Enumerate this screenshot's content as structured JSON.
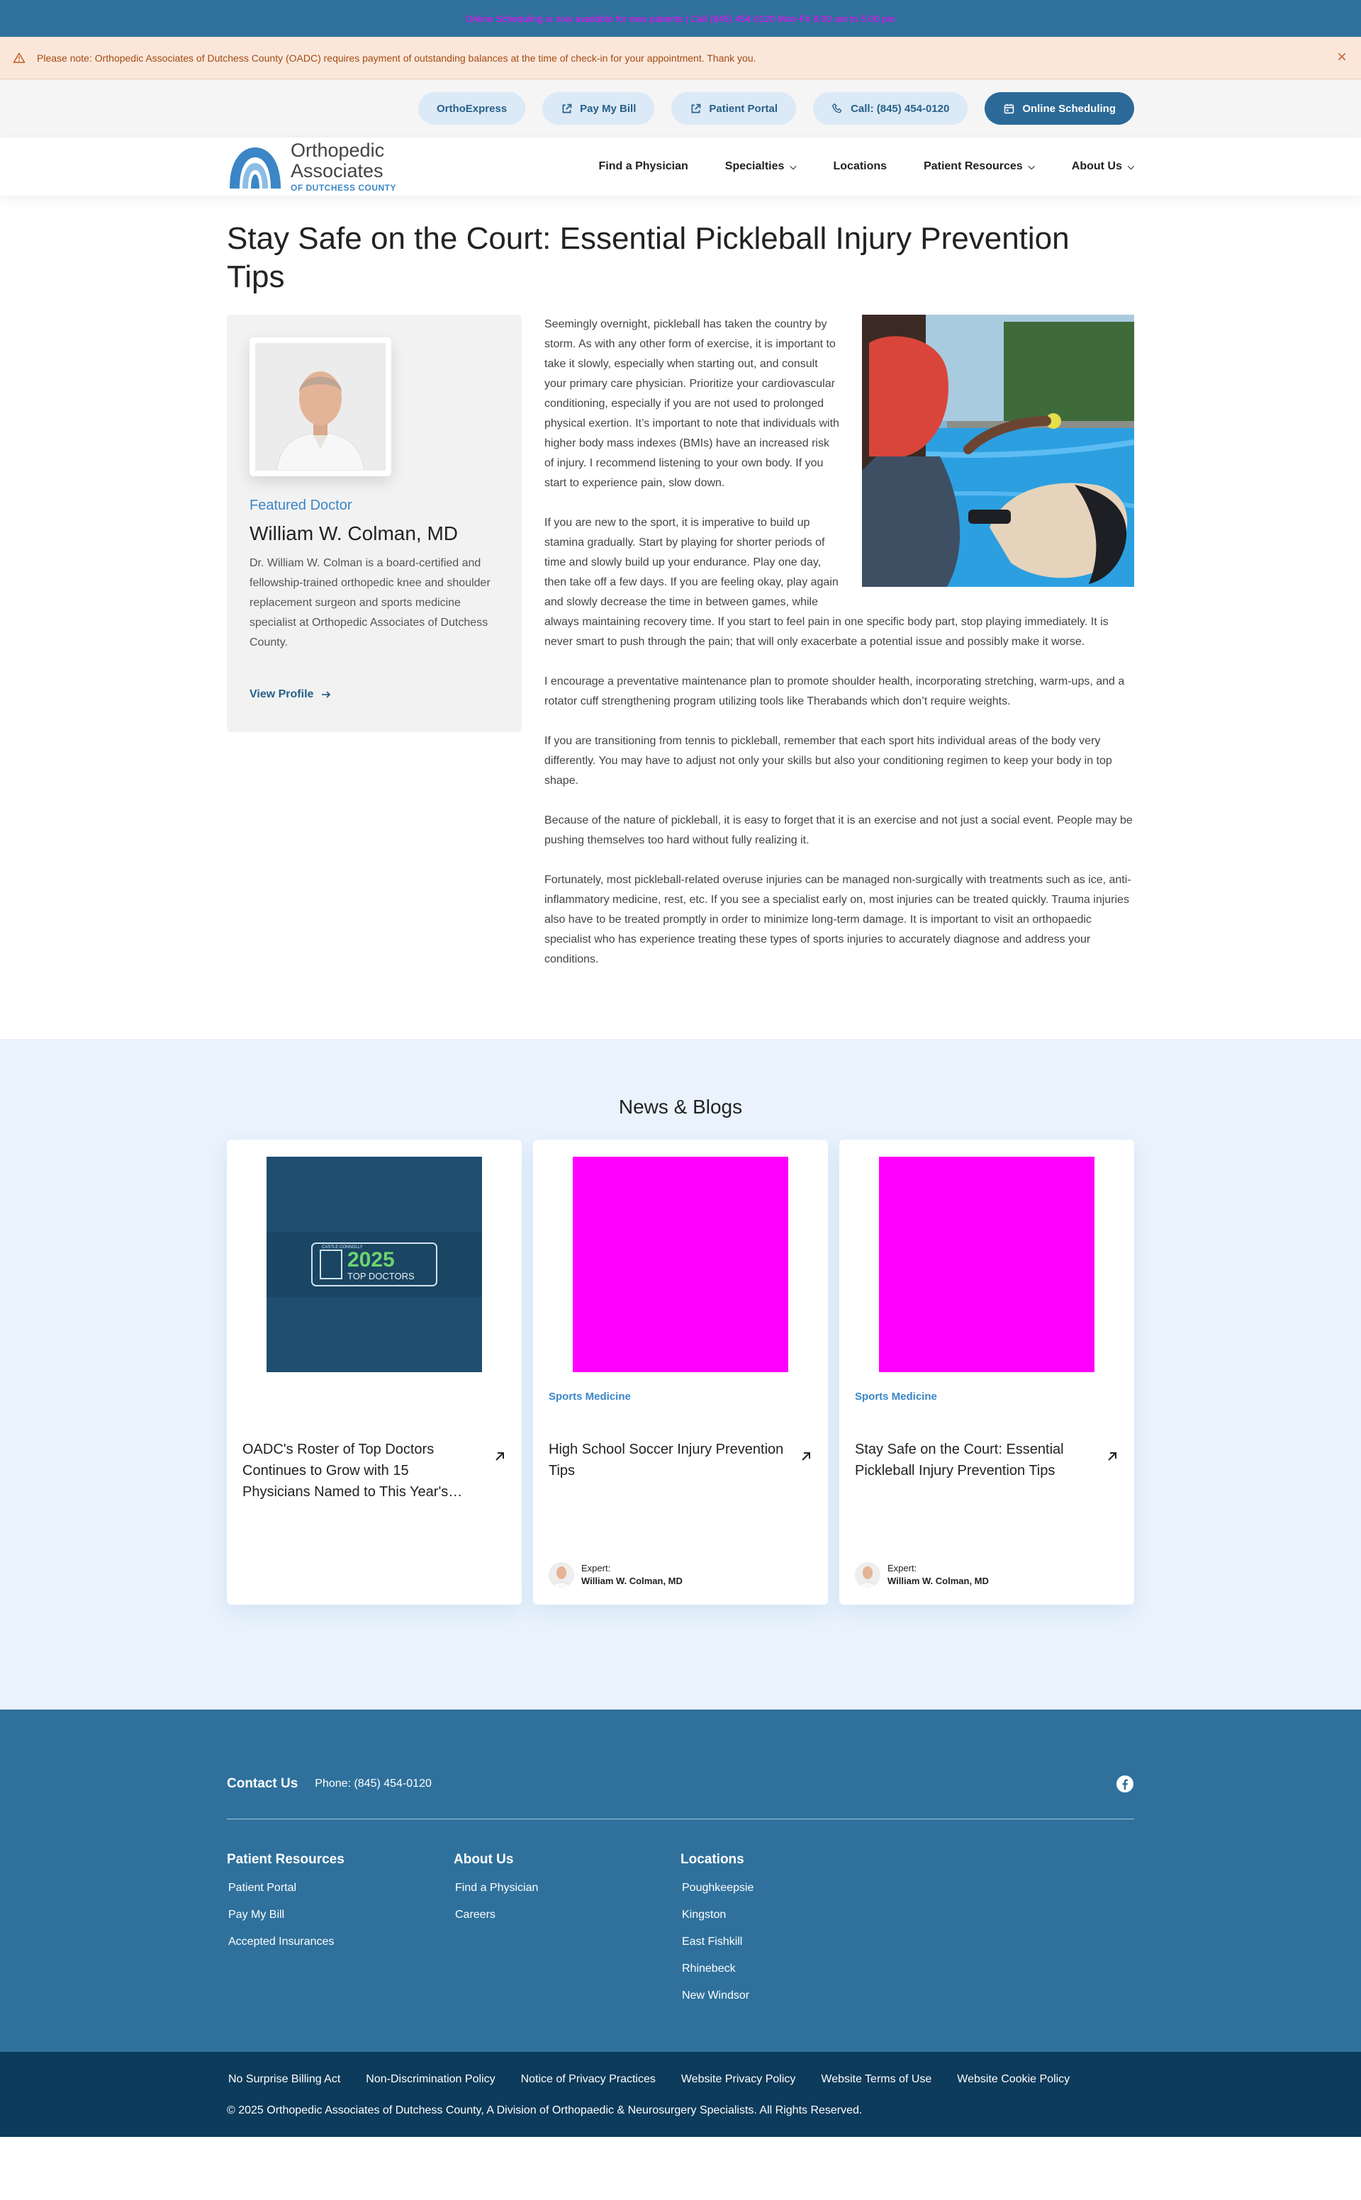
{
  "topbar": {
    "text": "Online Scheduling is now available for new patients | Call (845) 454-0120 Mon-Fri 8:00 am to 5:00 pm"
  },
  "notice": {
    "message": "Please note: Orthopedic Associates of Dutchess County (OADC) requires payment of outstanding balances at the time of check-in for your appointment. Thank you.",
    "icon": "warning-icon",
    "close": "×"
  },
  "utility": {
    "items": [
      {
        "label": "OrthoExpress"
      },
      {
        "label": "Pay My Bill",
        "icon": "external-link-icon"
      },
      {
        "label": "Patient Portal",
        "icon": "external-link-icon"
      },
      {
        "label": "Call: (845) 454-0120",
        "icon": "phone-icon"
      },
      {
        "label": "Online Scheduling",
        "icon": "calendar-icon"
      }
    ]
  },
  "logo": {
    "line1": "Orthopedic",
    "line2": "Associates",
    "line3": "OF DUTCHESS COUNTY"
  },
  "nav": {
    "items": [
      {
        "label": "Find a Physician"
      },
      {
        "label": "Specialties",
        "chevron": "⌄"
      },
      {
        "label": "Locations"
      },
      {
        "label": "Patient Resources",
        "chevron": "⌄"
      },
      {
        "label": "About Us",
        "chevron": "⌄"
      }
    ]
  },
  "article": {
    "title": "Stay Safe on the Court: Essential Pickleball Injury Prevention Tips",
    "paragraphs": [
      "Seemingly overnight, pickleball has taken the country by storm. As with any other form of exercise, it is important to take it slowly, especially when starting out, and consult your primary care physician. Prioritize your cardiovascular conditioning, especially if you are not used to prolonged physical exertion. It’s important to note that individuals with higher body mass indexes (BMIs) have an increased risk of injury. I recommend listening to your own body. If you start to experience pain, slow down.",
      "If you are new to the sport, it is imperative to build up stamina gradually. Start by playing for shorter periods of time and slowly build up your endurance. Play one day, then take off a few days. If you are feeling okay, play again and slowly decrease the time in between games, while always maintaining recovery time. If you start to feel pain in one specific body part, stop playing immediately. It is never smart to push through the pain; that will only exacerbate a potential issue and possibly make it worse.",
      "I encourage a preventative maintenance plan to promote shoulder health, incorporating stretching, warm-ups, and a rotator cuff strengthening program utilizing tools like Therabands which don’t require weights.",
      "If you are transitioning from tennis to pickleball, remember that each sport hits individual areas of the body very differently. You may have to adjust not only your skills but also your conditioning regimen to keep your body in top shape.",
      "Because of the nature of pickleball, it is easy to forget that it is an exercise and not just a social event. People may be pushing themselves too hard without fully realizing it.",
      "Fortunately, most pickleball-related overuse injuries can be managed non-surgically with treatments such as ice, anti-inflammatory medicine, rest, etc. If you see a specialist early on, most injuries can be treated quickly. Trauma injuries also have to be treated promptly in order to minimize long-term damage. It is important to visit an orthopaedic specialist who has experience treating these types of sports injuries to accurately diagnose and address your conditions."
    ]
  },
  "doctor": {
    "featured_label": "Featured Doctor",
    "name": "William W. Colman, MD",
    "bio": "Dr. William W. Colman is a board-certified and fellowship-trained orthopedic knee and shoulder replacement surgeon and sports medicine specialist at Orthopedic Associates of Dutchess County.",
    "link": "View Profile",
    "link_icon": "arrow-right-icon"
  },
  "news": {
    "heading": "News & Blogs",
    "cards": [
      {
        "tag": "",
        "title": "OADC's Roster of Top Doctors Continues to Grow with 15 Physicians Named to This Year's…",
        "badge_year": "2025",
        "badge_text": "TOP DOCTORS",
        "badge_brand": "CASTLE CONNOLLY",
        "expert_label": "",
        "expert_name": ""
      },
      {
        "tag": "Sports Medicine",
        "title": "High School Soccer Injury Prevention Tips",
        "expert_label": "Expert:",
        "expert_name": "William W. Colman, MD"
      },
      {
        "tag": "Sports Medicine",
        "title": "Stay Safe on the Court: Essential Pickleball Injury Prevention Tips",
        "expert_label": "Expert:",
        "expert_name": "William W. Colman, MD"
      }
    ]
  },
  "footer": {
    "contact_label": "Contact Us",
    "phone": "Phone: (845) 454-0120",
    "social_icon": "facebook-icon",
    "columns": [
      {
        "heading": "Patient Resources",
        "links": [
          "Patient Portal",
          "Pay My Bill",
          "Accepted Insurances"
        ]
      },
      {
        "heading": "About Us",
        "links": [
          "Find a Physician",
          "Careers"
        ]
      },
      {
        "heading": "Locations",
        "links": [
          "Poughkeepsie",
          "Kingston",
          "East Fishkill",
          "Rhinebeck",
          "New Windsor"
        ]
      }
    ]
  },
  "bottom": {
    "links": [
      "No Surprise Billing Act",
      "Non-Discrimination Policy",
      "Notice of Privacy Practices",
      "Website Privacy Policy",
      "Website Terms of Use",
      "Website Cookie Policy"
    ],
    "copyright": "© 2025 Orthopedic Associates of Dutchess County, A Division of Orthopaedic & Neurosurgery Specialists. All Rights Reserved."
  },
  "colors": {
    "brand": "#2f719c",
    "accent": "#3b86c6",
    "dark": "#0d3b5b",
    "notice_bg": "#fbe7da",
    "placeholder": "#ff00ff"
  }
}
